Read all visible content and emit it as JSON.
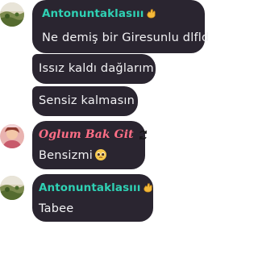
{
  "messages": [
    {
      "author": "Antonuntaklasııı",
      "author_emoji": "hand-gesture-icon",
      "author_color": "#2fd1b4",
      "avatar": "avatar-landscape",
      "text": "Ne demiş bir Giresunlu dlfld"
    },
    {
      "text": "Issız kaldı dağlarım"
    },
    {
      "text": "Sensiz kalmasın"
    },
    {
      "author": "Oglum Bak Git",
      "author_emoji": "cycle-icon",
      "author_color": "#ff6f86",
      "avatar": "avatar-portrait",
      "text": "Bensizmi",
      "text_emoji": "pleading-face-icon"
    },
    {
      "author": "Antonuntaklasııı",
      "author_emoji": "hand-gesture-icon",
      "author_color": "#2fd1b4",
      "avatar": "avatar-landscape",
      "text": "Tabee"
    }
  ],
  "colors": {
    "bubble": "#2a2530",
    "text": "#f2f2f4",
    "background": "#ffffff"
  }
}
